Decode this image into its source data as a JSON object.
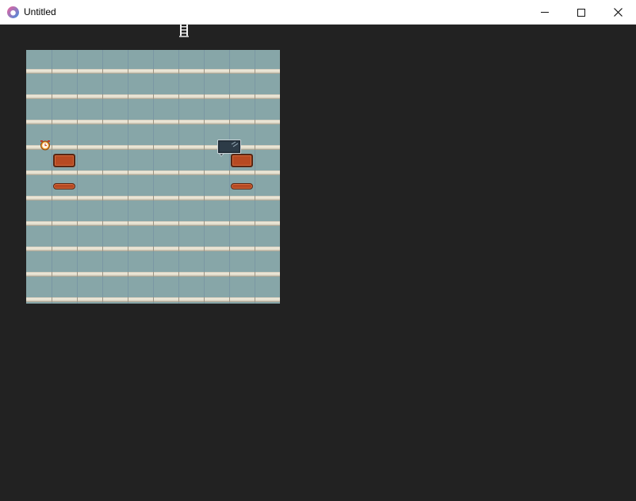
{
  "window": {
    "title": "Untitled",
    "controls": {
      "minimize_icon": "minimize-icon",
      "maximize_icon": "maximize-icon",
      "close_icon": "close-icon"
    }
  },
  "game": {
    "background_color": "#222222",
    "floor_color": "#87a6a8",
    "grid_columns": 10,
    "grid_rows": 10,
    "objects": [
      {
        "name": "ladder",
        "icon": "ladder-icon"
      },
      {
        "name": "alarm-clock",
        "icon": "alarm-clock-icon"
      },
      {
        "name": "rug-large-left",
        "icon": "rug-icon",
        "color": "#b74a22"
      },
      {
        "name": "rug-large-right",
        "icon": "rug-icon",
        "color": "#b74a22"
      },
      {
        "name": "rug-small-left",
        "icon": "rug-icon",
        "color": "#b74a22"
      },
      {
        "name": "rug-small-right",
        "icon": "rug-icon",
        "color": "#b74a22"
      },
      {
        "name": "television",
        "icon": "tv-icon"
      }
    ]
  }
}
